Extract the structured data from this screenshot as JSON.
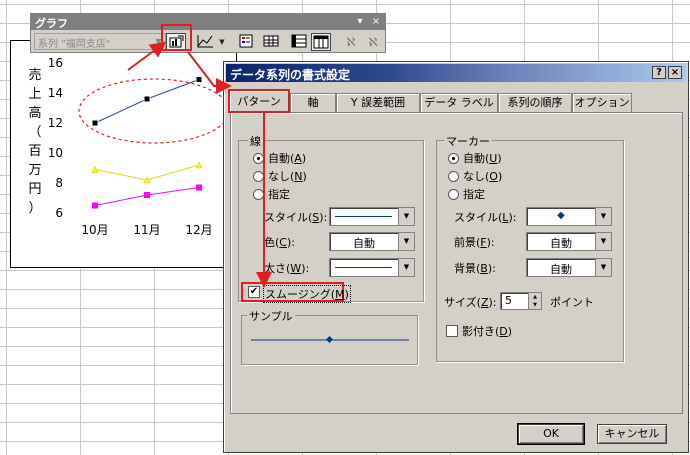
{
  "toolbar": {
    "title": "グラフ",
    "series_select_value": "系列 \"福岡支店\"",
    "minimize_glyph": "▾",
    "close_glyph": "×",
    "buttons": [
      "format-series-icon",
      "chart-type-icon",
      "legend-icon",
      "data-table-icon",
      "by-row-icon",
      "by-column-icon",
      "angle-text-down-icon",
      "angle-text-up-icon"
    ]
  },
  "chart": {
    "ylabel": "売上高（百万円）",
    "ylabel_chars": [
      "売",
      "上",
      "高",
      "（",
      "百",
      "万",
      "円",
      "）"
    ]
  },
  "chart_data": {
    "type": "line",
    "categories": [
      "10月",
      "11月",
      "12月"
    ],
    "y_ticks": [
      "16",
      "14",
      "12",
      "10",
      "8",
      "6"
    ],
    "ylim": [
      6,
      16
    ],
    "series": [
      {
        "values": [
          12.0,
          13.6,
          14.9
        ],
        "color": "#1f4e9c"
      },
      {
        "values": [
          8.9,
          8.2,
          9.2
        ],
        "color": "#ffff00"
      },
      {
        "values": [
          6.5,
          7.2,
          7.7
        ],
        "color": "#ff00ff"
      }
    ]
  },
  "dialog": {
    "title": "データ系列の書式設定",
    "help_btn": "?",
    "close_btn": "×",
    "tabs": [
      "パターン",
      "軸",
      "Y 誤差範囲",
      "データ ラベル",
      "系列の順序",
      "オプション"
    ],
    "line": {
      "group": "線",
      "auto": [
        "自動(",
        "A",
        ")"
      ],
      "none": [
        "なし(",
        "N",
        ")"
      ],
      "custom": "指定",
      "style": [
        "スタイル(",
        "S",
        "):"
      ],
      "color": [
        "色(",
        "C",
        "):"
      ],
      "color_value": "自動",
      "weight": [
        "太さ(",
        "W",
        "):"
      ],
      "smoothing": [
        "スムージング(",
        "M",
        ")"
      ],
      "smoothing_checked": true
    },
    "marker": {
      "group": "マーカー",
      "auto": [
        "自動(",
        "U",
        ")"
      ],
      "none": [
        "なし(",
        "O",
        ")"
      ],
      "custom": "指定",
      "style": [
        "スタイル(",
        "L",
        "):"
      ],
      "style_symbol": "◆",
      "foreground": [
        "前景(",
        "F",
        "):"
      ],
      "foreground_value": "自動",
      "background": [
        "背景(",
        "B",
        "):"
      ],
      "background_value": "自動",
      "size": [
        "サイズ(",
        "Z",
        "):"
      ],
      "size_value": "5",
      "size_unit": "ポイント",
      "shadow": [
        "影付き(",
        "D",
        ")"
      ],
      "shadow_checked": false
    },
    "sample": "サンプル",
    "ok": "OK",
    "cancel": "キャンセル"
  },
  "colors": {
    "highlight": "#e02020",
    "title_start": "#0a246a",
    "dialog_bg": "#d4d0c8"
  }
}
